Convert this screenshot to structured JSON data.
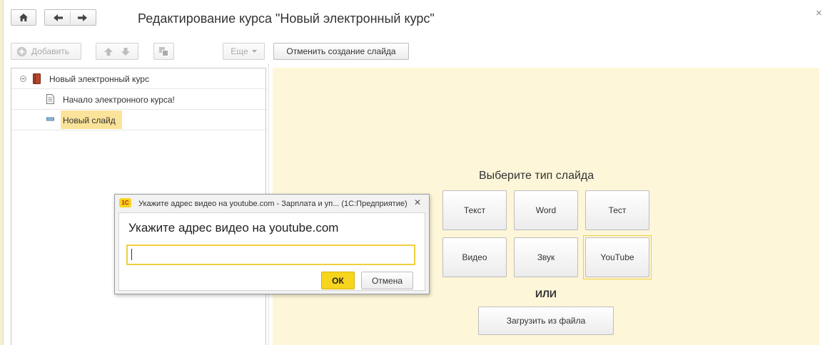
{
  "window": {
    "title": "Редактирование курса \"Новый электронный курс\"",
    "close_label": "×"
  },
  "toolbar": {
    "add_label": "Добавить",
    "more_label": "Еще",
    "cancel_slide_label": "Отменить создание слайда"
  },
  "tree": {
    "items": [
      {
        "label": "Новый электронный курс",
        "icon": "book-icon"
      },
      {
        "label": "Начало электронного курса!",
        "icon": "document-icon"
      },
      {
        "label": "Новый слайд",
        "icon": "slide-icon",
        "selected": true
      }
    ]
  },
  "slide_types": {
    "title": "Выберите тип слайда",
    "buttons": [
      "Текст",
      "Word",
      "Тест",
      "Видео",
      "Звук",
      "YouTube"
    ],
    "or_label": "ИЛИ",
    "upload_label": "Загрузить из файла"
  },
  "dialog": {
    "window_title": "Укажите адрес видео на youtube.com - Зарплата и уп...  (1С:Предприятие)",
    "app_badge": "1С",
    "prompt": "Укажите адрес видео на youtube.com",
    "input_value": "",
    "ok_label": "ОК",
    "cancel_label": "Отмена",
    "close_label": "✕"
  },
  "colors": {
    "panel_background": "#fdf6d9",
    "selection": "#fbe39a",
    "ok_button": "#f7d51d",
    "input_focus_border": "#f0cf3c"
  }
}
